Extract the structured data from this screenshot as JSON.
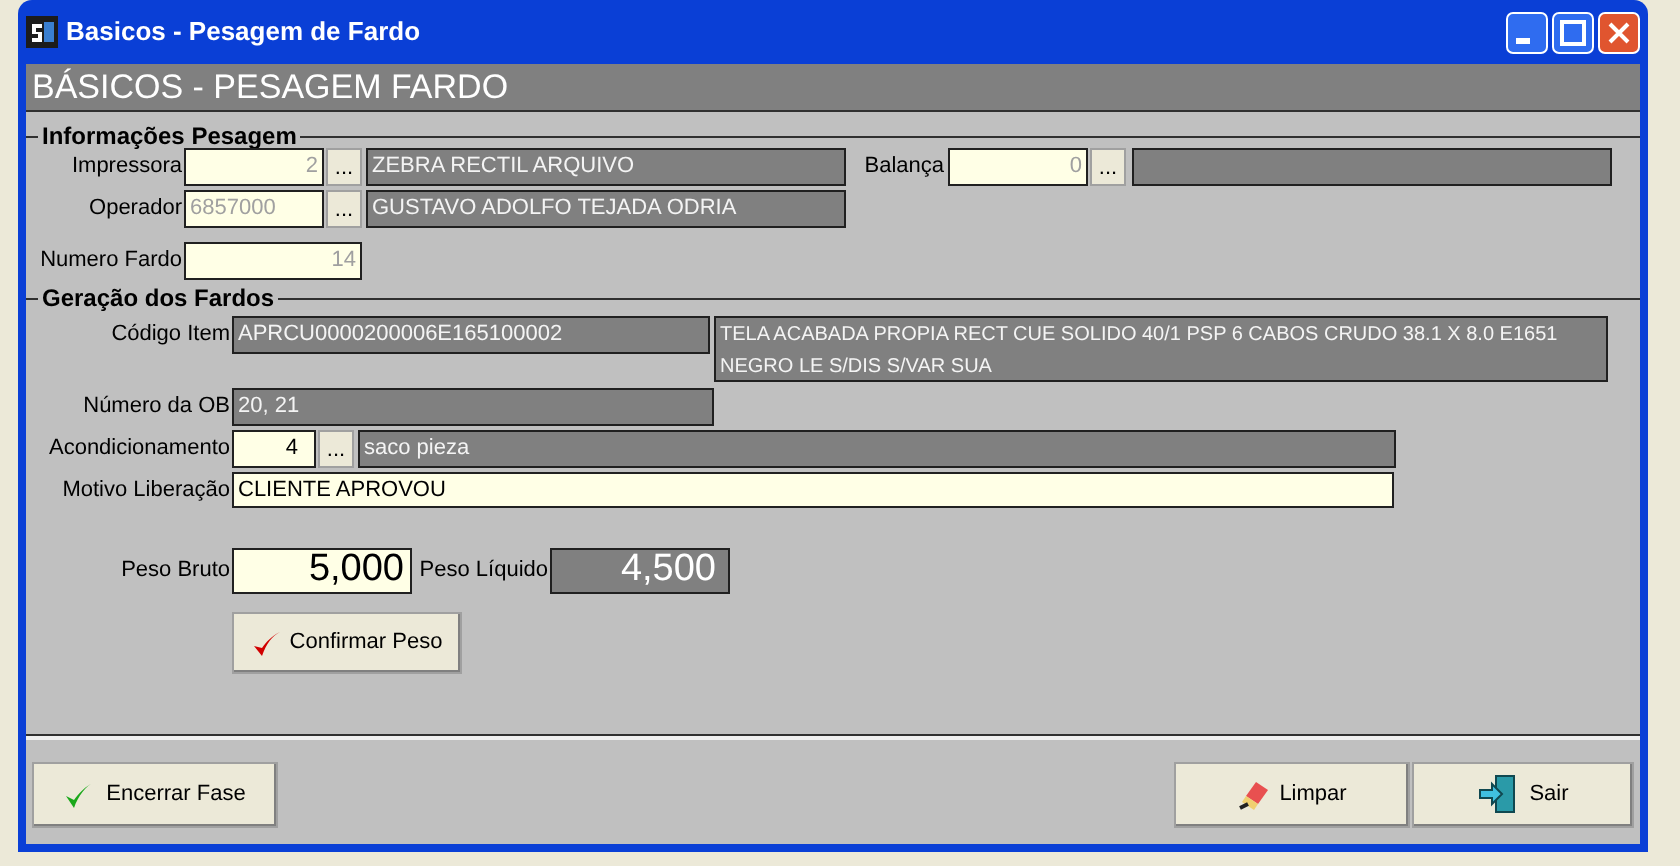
{
  "window": {
    "title": "Basicos - Pesagem de Fardo"
  },
  "header": "BÁSICOS - PESAGEM FARDO",
  "pesagem": {
    "legend": "Informações Pesagem",
    "impressora": {
      "label": "Impressora",
      "code": {
        "kind": "input",
        "value": "2",
        "disabled": true
      },
      "lookup": "...",
      "description": {
        "kind": "display",
        "value": "ZEBRA RECTIL ARQUIVO"
      }
    },
    "operador": {
      "label": "Operador",
      "code": {
        "kind": "input",
        "value": "6857000",
        "disabled": true
      },
      "lookup": "...",
      "description": {
        "kind": "display",
        "value": "GUSTAVO ADOLFO TEJADA ODRIA"
      }
    },
    "balanca": {
      "label": "Balança",
      "code": {
        "kind": "input",
        "value": "0",
        "disabled": true
      },
      "lookup": "...",
      "description": {
        "kind": "display"
      }
    },
    "numero_fardo": {
      "label": "Numero Fardo",
      "field": {
        "kind": "input",
        "value": "14",
        "disabled": true
      }
    }
  },
  "geracao": {
    "legend": "Geração dos Fardos",
    "codigo_item": {
      "label": "Código Item",
      "code": {
        "kind": "display",
        "value": "APRCU0000200006E165100002"
      },
      "description": {
        "kind": "display",
        "value": "TELA ACABADA PROPIA RECT CUE SOLIDO 40/1 PSP 6 CABOS CRUDO 38.1 X 8.0 E1651 NEGRO LE S/DIS S/VAR SUA"
      }
    },
    "numero_ob": {
      "label": "Número da OB",
      "field": {
        "kind": "display",
        "value": "20, 21"
      }
    },
    "acondicionamento": {
      "label": "Acondicionamento",
      "code": {
        "kind": "input",
        "value": "4",
        "disabled": false
      },
      "lookup": "...",
      "description": {
        "kind": "display",
        "value": "saco pieza"
      }
    },
    "motivo": {
      "label": "Motivo Liberação",
      "field": {
        "kind": "input",
        "value": "CLIENTE APROVOU",
        "disabled": false
      }
    },
    "peso_bruto": {
      "label": "Peso Bruto",
      "field": {
        "kind": "input",
        "value": "5,000",
        "disabled": false
      }
    },
    "peso_liquido": {
      "label": "Peso Líquido",
      "field": {
        "kind": "display",
        "value": "4,500"
      }
    },
    "confirm_button": "Confirmar Peso"
  },
  "footer": {
    "encerrar": "Encerrar Fase",
    "limpar": "Limpar",
    "sair": "Sair"
  }
}
